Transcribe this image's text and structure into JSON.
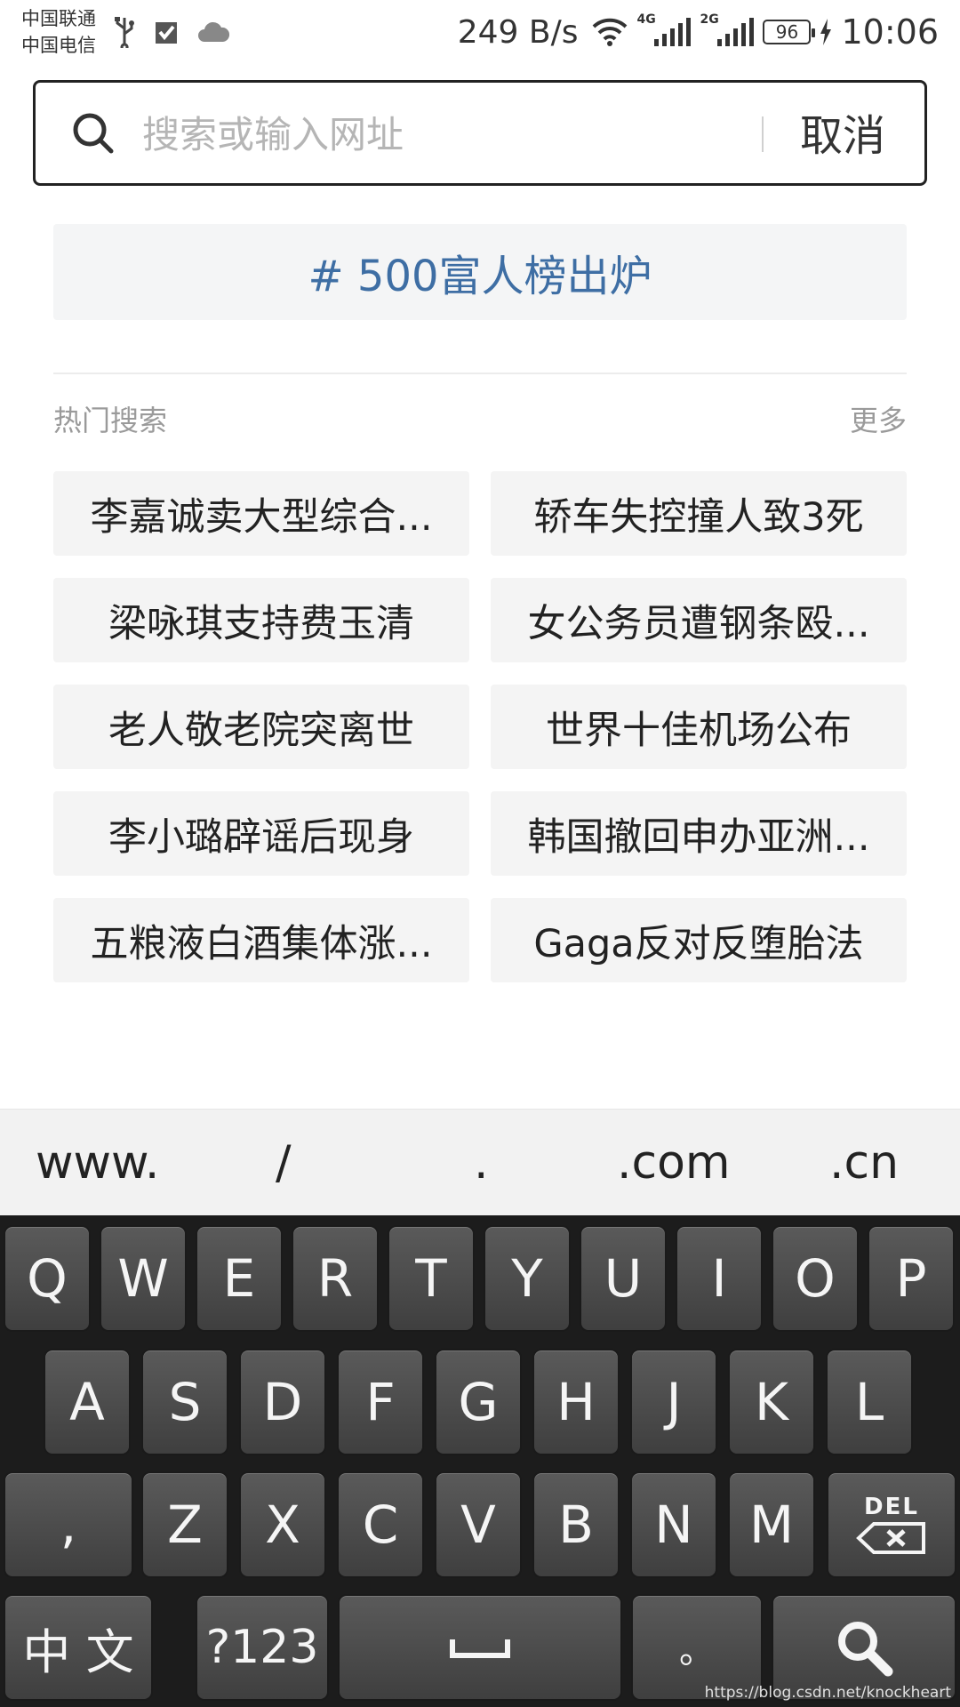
{
  "status_bar": {
    "carrier_1": "中国联通",
    "carrier_2": "中国电信",
    "net_speed": "249 B/s",
    "signal_1_type": "4G",
    "signal_2_type": "2G",
    "battery": "96",
    "time": "10:06",
    "icons": [
      "usb-icon",
      "check-icon",
      "cloud-icon",
      "wifi-icon",
      "signal-icon",
      "charging-icon"
    ]
  },
  "search": {
    "placeholder": "搜索或输入网址",
    "cancel_label": "取消"
  },
  "trending_banner": "# 500富人榜出炉",
  "hot": {
    "title": "热门搜索",
    "more_label": "更多",
    "items": [
      "李嘉诚卖大型综合...",
      "轿车失控撞人致3死",
      "梁咏琪支持费玉清",
      "女公务员遭钢条殴...",
      "老人敬老院突离世",
      "世界十佳机场公布",
      "李小璐辟谣后现身",
      "韩国撤回申办亚洲...",
      "五粮液白酒集体涨...",
      "Gaga反对反堕胎法"
    ]
  },
  "url_shortcuts": [
    "www.",
    "/",
    ".",
    ".com",
    ".cn"
  ],
  "keyboard": {
    "row1": [
      "Q",
      "W",
      "E",
      "R",
      "T",
      "Y",
      "U",
      "I",
      "O",
      "P"
    ],
    "row2": [
      "A",
      "S",
      "D",
      "F",
      "G",
      "H",
      "J",
      "K",
      "L"
    ],
    "row3": [
      ",",
      "Z",
      "X",
      "C",
      "V",
      "B",
      "N",
      "M"
    ],
    "del_label": "DEL",
    "lang_label": "中 文",
    "symbols_label": "?123",
    "space_label": "␣",
    "period_label": "。"
  },
  "watermark": "https://blog.csdn.net/knockheart"
}
